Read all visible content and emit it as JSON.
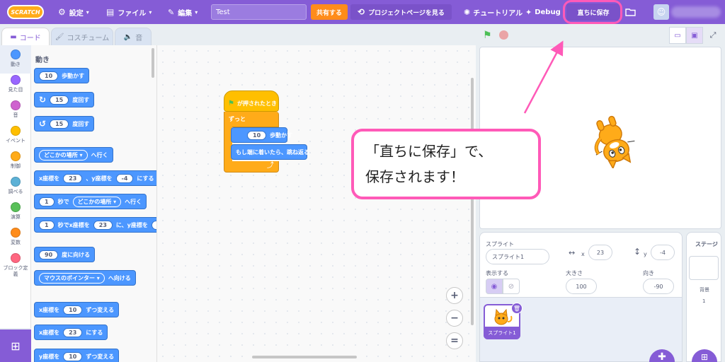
{
  "menubar": {
    "logo": "SCRATCH",
    "settings": "設定",
    "file": "ファイル",
    "edit": "編集",
    "project_title": "Test",
    "share": "共有する",
    "project_page": "プロジェクトページを見る",
    "tutorial": "チュートリアル",
    "debug": "Debug",
    "save_now": "直ちに保存"
  },
  "tabs": {
    "code": "コード",
    "costumes": "コスチューム",
    "sounds": "音"
  },
  "categories": [
    {
      "label": "動き",
      "color": "#4c97ff"
    },
    {
      "label": "見た目",
      "color": "#9966ff"
    },
    {
      "label": "音",
      "color": "#cf63cf"
    },
    {
      "label": "イベント",
      "color": "#ffbf00"
    },
    {
      "label": "制御",
      "color": "#ffab19"
    },
    {
      "label": "調べる",
      "color": "#5cb1d6"
    },
    {
      "label": "演算",
      "color": "#59c059"
    },
    {
      "label": "変数",
      "color": "#ff8c1a"
    },
    {
      "label": "ブロック定義",
      "color": "#ff6680"
    }
  ],
  "palette": {
    "title": "動き",
    "move_steps": "10",
    "move_label": "歩動かす",
    "turn_right_deg": "15",
    "turn_right_label": "度回す",
    "turn_left_deg": "15",
    "turn_left_label": "度回す",
    "goto_target": "どこかの場所",
    "goto_label": "へ行く",
    "gotoxy_x_label": "x座標を",
    "gotoxy_x": "23",
    "gotoxy_y_label": "、y座標を",
    "gotoxy_y": "-4",
    "gotoxy_end": "にする",
    "glide_secs": "1",
    "glide_mid": "秒で",
    "glide_target": "どこかの場所",
    "glide_end": "へ行く",
    "glidexy_secs": "1",
    "glidexy_mid": "秒でx座標を",
    "glidexy_x": "23",
    "glidexy_mid2": "に、y座標を",
    "glidexy_y": "-",
    "point_deg": "90",
    "point_label": "度に向ける",
    "point_towards_target": "マウスのポインター",
    "point_towards_label": "へ向ける",
    "change_x_label": "x座標を",
    "change_x": "10",
    "change_x_end": "ずつ変える",
    "set_x_label": "x座標を",
    "set_x": "23",
    "set_x_end": "にする",
    "change_y_label": "y座標を",
    "change_y": "10",
    "change_y_end": "ずつ変える"
  },
  "script": {
    "hat": "が押されたとき",
    "forever": "ずっと",
    "move_steps": "10",
    "move_label": "歩動かす",
    "bounce": "もし端に着いたら、跳ね返る"
  },
  "callout": {
    "line1": "「直ちに保存」で、",
    "line2": "保存されます！"
  },
  "zoom": {
    "in": "+",
    "out": "−",
    "reset": "="
  },
  "sprite_info": {
    "sprite_label": "スプライト",
    "sprite_name": "スプライト1",
    "x_label": "x",
    "x_value": "23",
    "y_label": "y",
    "y_value": "-4",
    "show_label": "表示する",
    "size_label": "大きさ",
    "size_value": "100",
    "direction_label": "向き",
    "direction_value": "-90"
  },
  "sprite_list": [
    {
      "name": "スプライト1"
    }
  ],
  "stage_pane": {
    "title": "ステージ",
    "backdrop_label": "背景",
    "backdrop_count": "1"
  },
  "colors": {
    "accent": "#855cd6",
    "motion": "#4c97ff",
    "events": "#ffbf00",
    "control": "#ffab19",
    "highlight": "#ff5ab8",
    "share": "#ff8c1a"
  }
}
